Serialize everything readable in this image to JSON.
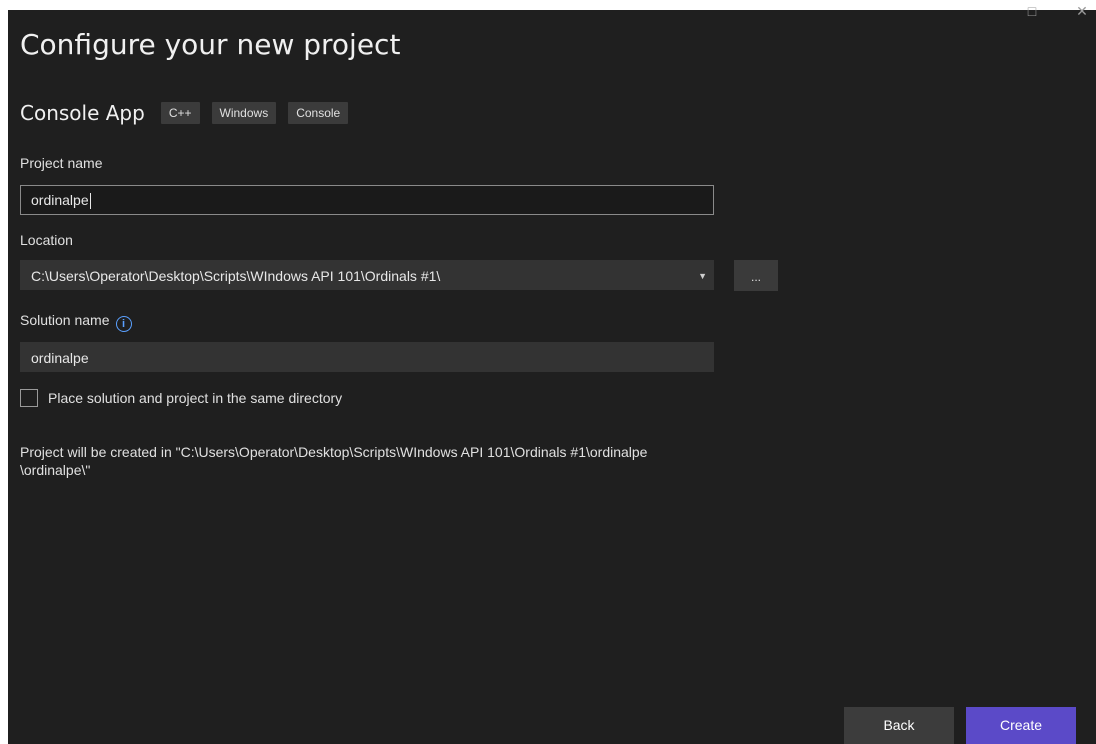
{
  "window": {
    "controls": {
      "maximize_icon": "maximize-icon",
      "close_icon": "close-icon",
      "maximize_glyph": "□",
      "close_glyph": "✕"
    }
  },
  "header": {
    "title": "Configure your new project"
  },
  "template": {
    "name": "Console App",
    "tags": [
      "C++",
      "Windows",
      "Console"
    ]
  },
  "project_name": {
    "label": "Project name",
    "value": "ordinalpe"
  },
  "location": {
    "label": "Location",
    "value": "C:\\Users\\Operator\\Desktop\\Scripts\\WIndows API 101\\Ordinals #1\\",
    "browse_label": "..."
  },
  "solution_name": {
    "label": "Solution name",
    "value": "ordinalpe",
    "info_glyph": "i"
  },
  "same_directory": {
    "label": "Place solution and project in the same directory",
    "checked": false
  },
  "created_note": {
    "line1": "Project will be created in \"C:\\Users\\Operator\\Desktop\\Scripts\\WIndows API 101\\Ordinals #1\\ordinalpe",
    "line2": "\\ordinalpe\\\""
  },
  "footer": {
    "back_label": "Back",
    "create_label": "Create"
  },
  "colors": {
    "background": "#1f1f1f",
    "accent": "#5b4ac8",
    "info": "#5aa0ff"
  }
}
